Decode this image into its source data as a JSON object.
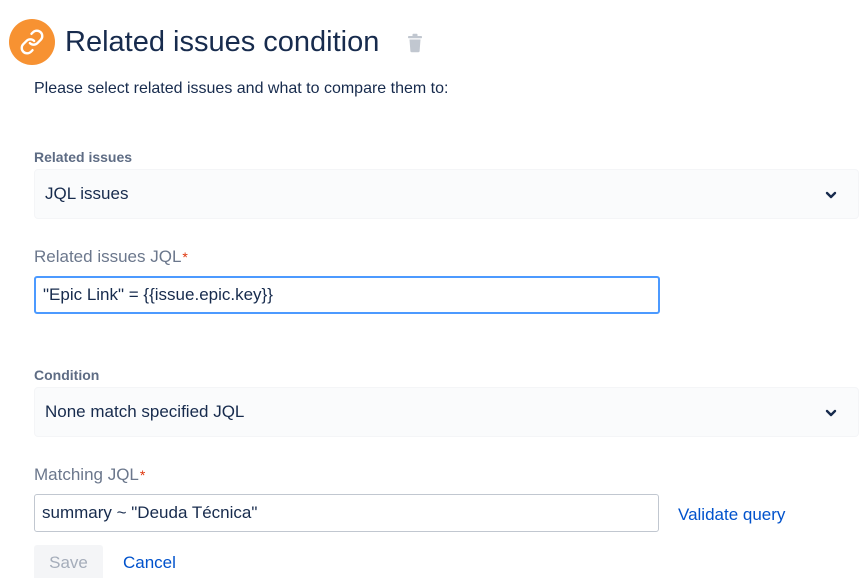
{
  "header": {
    "title": "Related issues condition",
    "icon": "link-icon",
    "icon_bg": "#f79232"
  },
  "intro_text": "Please select related issues and what to compare them to:",
  "related_issues": {
    "label": "Related issues",
    "selected": "JQL issues"
  },
  "related_jql": {
    "label": "Related issues JQL",
    "required_mark": "*",
    "value": "\"Epic Link\" = {{issue.epic.key}}"
  },
  "condition": {
    "label": "Condition",
    "selected": "None match specified JQL"
  },
  "matching_jql": {
    "label": "Matching JQL",
    "required_mark": "*",
    "value": "summary ~ \"Deuda Técnica\"",
    "validate_label": "Validate query"
  },
  "actions": {
    "save_label": "Save",
    "cancel_label": "Cancel"
  },
  "colors": {
    "accent": "#0052cc",
    "required": "#de350b",
    "focus_border": "#4c9aff"
  }
}
